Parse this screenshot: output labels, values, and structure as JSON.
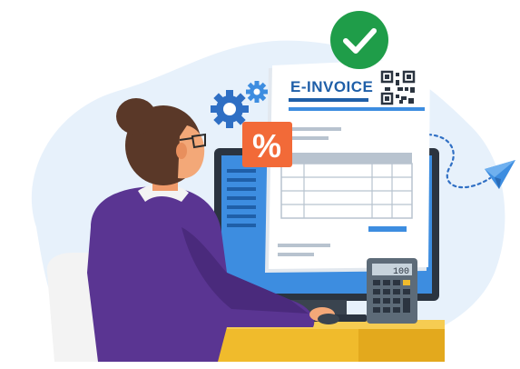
{
  "invoice": {
    "title": "E-INVOICE"
  },
  "badge": {
    "percent_symbol": "%"
  },
  "calculator": {
    "display": "100"
  },
  "icons": {
    "check": "check-icon",
    "gears": "gear-icon",
    "qr": "qr-code-icon",
    "send": "paper-plane-icon"
  },
  "colors": {
    "background_blob": "#e7f1fb",
    "check_green": "#1f9d49",
    "percent_orange": "#f26a38",
    "gear_blue": "#2f6fc4",
    "screen_blue": "#3d8de0",
    "sweater_purple": "#5a3592",
    "hair_brown": "#5a3828",
    "desk_yellow": "#f0bb2c",
    "chair_white": "#f3f3f3",
    "calculator_gray": "#5d6b78"
  }
}
